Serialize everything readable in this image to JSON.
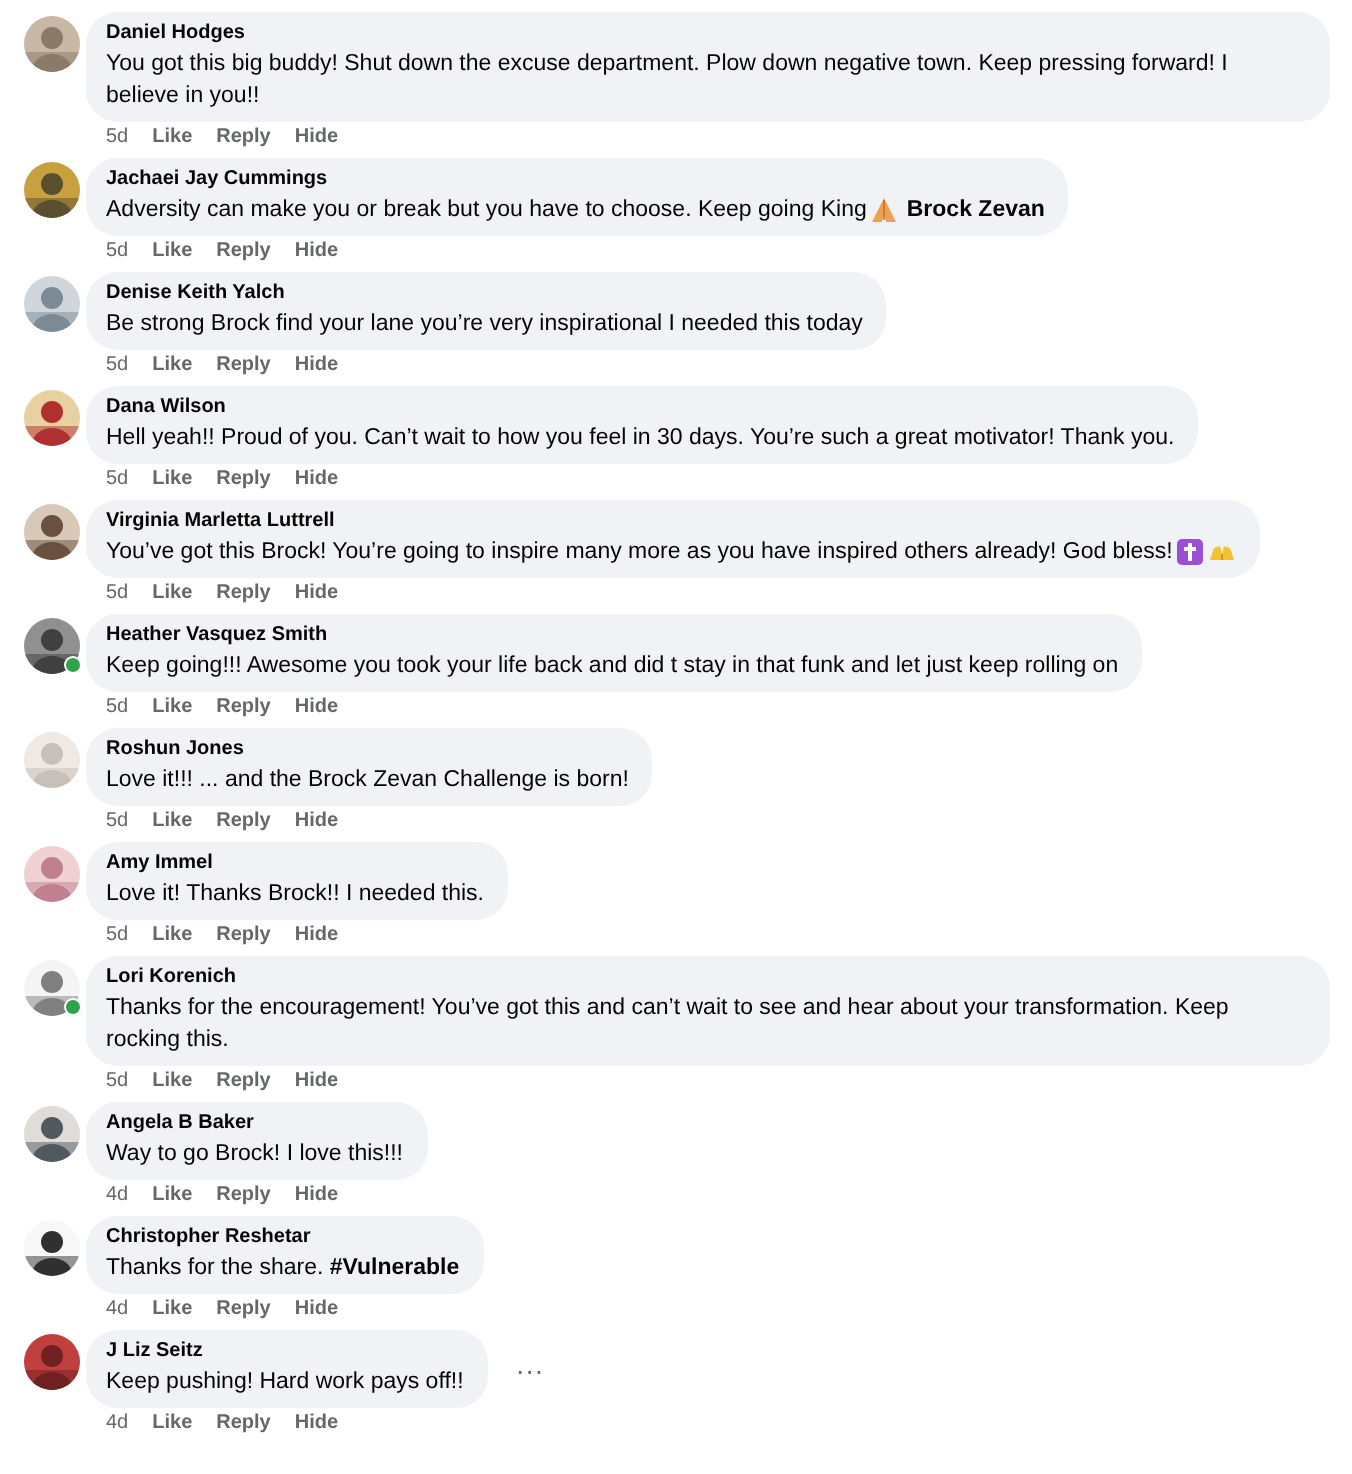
{
  "comments": [
    {
      "author": "Daniel Hodges",
      "online": false,
      "parts": [
        {
          "kind": "text",
          "text": "You got this big buddy! Shut down the excuse department. Plow down negative town. Keep pressing forward! I believe in you!!"
        }
      ],
      "time": "5d",
      "actions": [
        "Like",
        "Reply",
        "Hide"
      ]
    },
    {
      "author": "Jachaei Jay Cummings",
      "online": false,
      "parts": [
        {
          "kind": "text",
          "text": "Adversity can make you or break but you have to choose. Keep going King"
        },
        {
          "kind": "praying"
        },
        {
          "kind": "mention",
          "text": "Brock Zevan"
        }
      ],
      "time": "5d",
      "actions": [
        "Like",
        "Reply",
        "Hide"
      ]
    },
    {
      "author": "Denise Keith Yalch",
      "online": false,
      "parts": [
        {
          "kind": "text",
          "text": "Be strong Brock find your lane you’re very inspirational I needed this today"
        }
      ],
      "time": "5d",
      "actions": [
        "Like",
        "Reply",
        "Hide"
      ]
    },
    {
      "author": "Dana Wilson",
      "online": false,
      "parts": [
        {
          "kind": "text",
          "text": "Hell yeah!! Proud of you. Can’t wait to how you feel in 30 days. You’re such a great motivator! Thank you."
        }
      ],
      "time": "5d",
      "actions": [
        "Like",
        "Reply",
        "Hide"
      ]
    },
    {
      "author": "Virginia Marletta Luttrell",
      "online": false,
      "parts": [
        {
          "kind": "text",
          "text": "You’ve got this Brock! You’re going to inspire many more as you have inspired others already! God bless!"
        },
        {
          "kind": "cross"
        },
        {
          "kind": "raising"
        }
      ],
      "time": "5d",
      "actions": [
        "Like",
        "Reply",
        "Hide"
      ]
    },
    {
      "author": "Heather Vasquez Smith",
      "online": true,
      "parts": [
        {
          "kind": "text",
          "text": "Keep going!!! Awesome you took your life back and did t stay in that funk and let just keep rolling on"
        }
      ],
      "time": "5d",
      "actions": [
        "Like",
        "Reply",
        "Hide"
      ]
    },
    {
      "author": "Roshun Jones",
      "online": false,
      "parts": [
        {
          "kind": "text",
          "text": "Love it!!! ... and the Brock Zevan Challenge is born!"
        }
      ],
      "time": "5d",
      "actions": [
        "Like",
        "Reply",
        "Hide"
      ]
    },
    {
      "author": "Amy Immel",
      "online": false,
      "parts": [
        {
          "kind": "text",
          "text": "Love it! Thanks Brock!! I needed this."
        }
      ],
      "time": "5d",
      "actions": [
        "Like",
        "Reply",
        "Hide"
      ]
    },
    {
      "author": "Lori Korenich",
      "online": true,
      "parts": [
        {
          "kind": "text",
          "text": "Thanks for the encouragement! You’ve got this and can’t wait to see and hear about your transformation. Keep rocking this."
        }
      ],
      "time": "5d",
      "actions": [
        "Like",
        "Reply",
        "Hide"
      ]
    },
    {
      "author": "Angela B Baker",
      "online": false,
      "parts": [
        {
          "kind": "text",
          "text": "Way to go Brock! I love this!!!"
        }
      ],
      "time": "4d",
      "actions": [
        "Like",
        "Reply",
        "Hide"
      ]
    },
    {
      "author": "Christopher Reshetar",
      "online": false,
      "parts": [
        {
          "kind": "text",
          "text": "Thanks for the share. **#Vulnerable**"
        }
      ],
      "time": "4d",
      "actions": [
        "Like",
        "Reply",
        "Hide"
      ]
    },
    {
      "author": "J Liz Seitz",
      "online": false,
      "parts": [
        {
          "kind": "text",
          "text": "Keep pushing! Hard work pays off!!"
        }
      ],
      "time": "4d",
      "actions": [
        "Like",
        "Reply",
        "Hide"
      ],
      "more": "···"
    }
  ]
}
